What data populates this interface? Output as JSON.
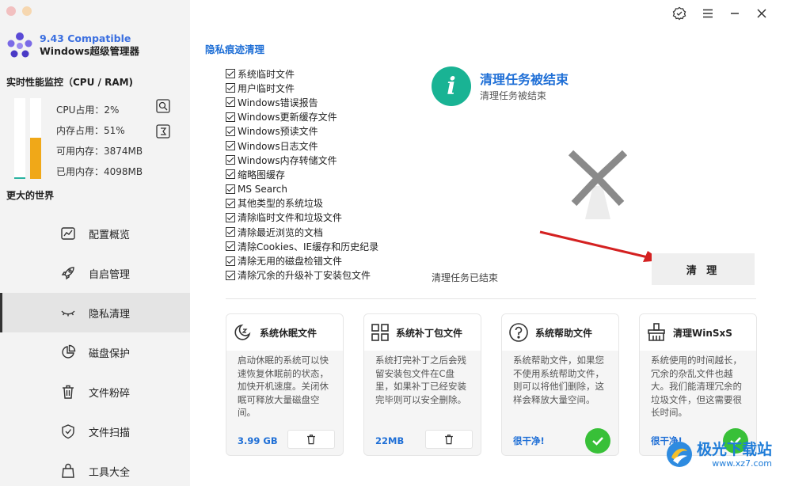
{
  "app": {
    "version": "9.43 Compatible",
    "name": "Windows超级管理器"
  },
  "monitor": {
    "title": "实时性能监控（CPU / RAM)",
    "cpu_label": "CPU占用：2%",
    "mem_label": "内存占用：51%",
    "avail_label": "可用内存：3874MB",
    "used_label": "已用内存：4098MB",
    "cpu_usage_percent": 2,
    "mem_usage_percent": 51,
    "colors": {
      "cpu": "#2bb3a1",
      "mem": "#f0a818"
    }
  },
  "sidebar": {
    "world": "更大的世界",
    "items": [
      {
        "label": "配置概览",
        "icon": "chart-icon"
      },
      {
        "label": "自启管理",
        "icon": "rocket-icon"
      },
      {
        "label": "隐私清理",
        "icon": "eye-closed-icon",
        "active": true
      },
      {
        "label": "磁盘保护",
        "icon": "pie-icon"
      },
      {
        "label": "文件粉碎",
        "icon": "trash-icon"
      },
      {
        "label": "文件扫描",
        "icon": "shield-icon"
      },
      {
        "label": "工具大全",
        "icon": "bag-icon"
      }
    ]
  },
  "privacy": {
    "title": "隐私痕迹清理",
    "items": [
      "系统临时文件",
      "用户临时文件",
      "Windows错误报告",
      "Windows更新缓存文件",
      "Windows预读文件",
      "Windows日志文件",
      "Windows内存转储文件",
      "缩略图缓存",
      "MS Search",
      "其他类型的系统垃圾",
      "清除临时文件和垃圾文件",
      "清除最近浏览的文档",
      "清除Cookies、IE缓存和历史纪录",
      "清除无用的磁盘检错文件",
      "清除冗余的升级补丁安装包文件"
    ]
  },
  "status": {
    "title": "清理任务被结束",
    "subtitle": "清理任务被结束",
    "ended": "清理任务已结束",
    "accent": "#19b394"
  },
  "clean_button": "清 理",
  "cards": [
    {
      "title": "系统休眠文件",
      "icon": "sleep-icon",
      "desc": "启动休眠的系统可以快速恢复休眠前的状态，加快开机速度。关闭休眠可释放大量磁盘空间。",
      "value": "3.99 GB",
      "action": "trash"
    },
    {
      "title": "系统补丁包文件",
      "icon": "grid-icon",
      "desc": "系统打完补丁之后会残留安装包文件在C盘里，如果补丁已经安装完毕则可以安全删除。",
      "value": "22MB",
      "action": "trash"
    },
    {
      "title": "系统帮助文件",
      "icon": "question-icon",
      "desc": "系统帮助文件，如果您不使用系统帮助文件，则可以将他们删除，这样会释放大量空间。",
      "value": "很干净!",
      "action": "ok"
    },
    {
      "title": "清理WinSxS",
      "icon": "broom-icon",
      "desc": "系统使用的时间越长，冗余的杂乱文件也越大。我们能清理冗余的垃圾文件，但这需要很长时间。",
      "value": "很干净!",
      "action": "ok"
    }
  ],
  "watermark": {
    "text": "极光下载站",
    "url": "www.xz7.com"
  }
}
